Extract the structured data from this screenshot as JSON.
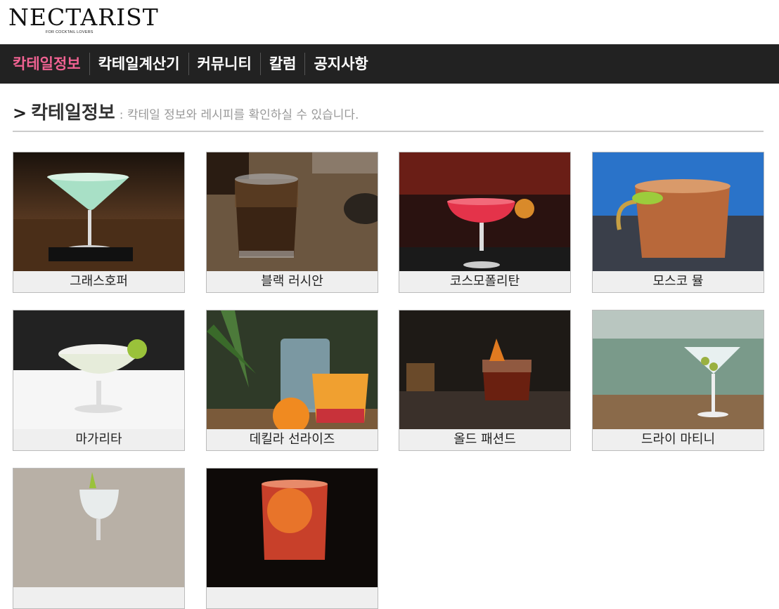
{
  "logo": {
    "text": "NECTARIST",
    "tagline": "FOR COCKTAIL LOVERS"
  },
  "nav": {
    "items": [
      {
        "label": "칵테일정보",
        "active": true
      },
      {
        "label": "칵테일계산기",
        "active": false
      },
      {
        "label": "커뮤니티",
        "active": false
      },
      {
        "label": "칼럼",
        "active": false
      },
      {
        "label": "공지사항",
        "active": false
      }
    ]
  },
  "section": {
    "chevron": ">",
    "title": "칵테일정보",
    "subtitle": ": 칵테일 정보와 레시피를 확인하실 수 있습니다."
  },
  "cocktails": [
    {
      "name": "그래스호퍼"
    },
    {
      "name": "블랙 러시안"
    },
    {
      "name": "코스모폴리탄"
    },
    {
      "name": "모스코 뮬"
    },
    {
      "name": "마가리타"
    },
    {
      "name": "데킬라 선라이즈"
    },
    {
      "name": "올드 패션드"
    },
    {
      "name": "드라이 마티니"
    },
    {
      "name": ""
    },
    {
      "name": ""
    }
  ],
  "colors": {
    "nav_bg": "#222222",
    "active": "#f06292"
  }
}
